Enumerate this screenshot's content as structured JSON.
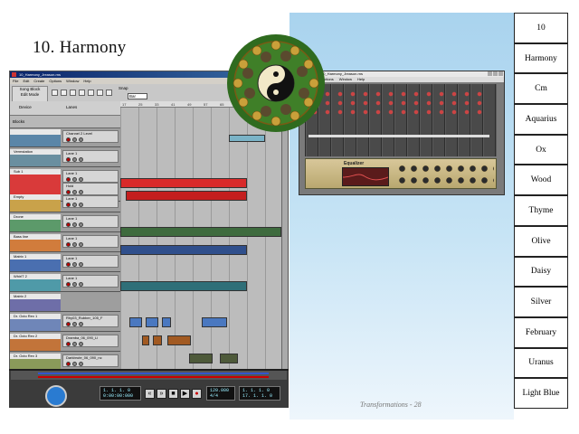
{
  "slide": {
    "title": "10. Harmony",
    "footer": "Transformations - 28"
  },
  "sequencer": {
    "window_title": "10_Harmony_Jreason.rns",
    "menu": [
      "File",
      "Edit",
      "Create",
      "Options",
      "Window",
      "Help"
    ],
    "mode": {
      "song": "Song",
      "block": "Block",
      "edit_mode": "Edit Mode"
    },
    "snap_label": "Snap",
    "snap_value": "Bar",
    "header": {
      "device": "Device",
      "lanes": "Lanes"
    },
    "blocks_label": "Blocks",
    "ruler": [
      "17",
      "25",
      "33",
      "41",
      "49",
      "57",
      "65",
      "73",
      "81",
      "89",
      "97"
    ],
    "tracks": [
      {
        "name": "",
        "lanes": [
          "Channel 2 Level"
        ],
        "color": "#5b86a8"
      },
      {
        "name": "Vermstation",
        "lanes": [
          "Lane 1"
        ],
        "color": "#6a8fa0"
      },
      {
        "name": "Sub 1",
        "lanes": [
          "Lane 1",
          "Hold"
        ],
        "color": "#d93a3a"
      },
      {
        "name": "Empty",
        "lanes": [
          "Lane 1"
        ],
        "color": "#c9a24a"
      },
      {
        "name": "Drone",
        "lanes": [
          "Lane 1"
        ],
        "color": "#5c9a6a"
      },
      {
        "name": "Bass line",
        "lanes": [
          "Lane 1"
        ],
        "color": "#d17c3c"
      },
      {
        "name": "Matrix 1",
        "lanes": [
          "Lane 1"
        ],
        "color": "#4a6fb0"
      },
      {
        "name": "WhirlT 2",
        "lanes": [
          "Lane 1"
        ],
        "color": "#4f9aa8"
      },
      {
        "name": "Matrix 2",
        "lanes": [],
        "color": "#6e6ea8"
      },
      {
        "name": "Dr. Octo Rex 1",
        "lanes": [
          "Rhy03_Rubber_105_F"
        ],
        "color": "#6f86b8"
      },
      {
        "name": "Dr. Octo Rex 2",
        "lanes": [
          "Dramba_06_090_Ll"
        ],
        "color": "#c2743a"
      },
      {
        "name": "Dr. Octo Rex 3",
        "lanes": [
          "Darkbrute_06_090_nc"
        ],
        "color": "#8a9a5a"
      }
    ],
    "transport": {
      "position": "1. 1. 1. 0",
      "time": "0:00:00:000",
      "tempo": "120.000",
      "signature": "4/4",
      "left_loc": "1. 1. 1. 0",
      "right_loc": "17. 1. 1. 0",
      "quant": "Loop"
    }
  },
  "mixer": {
    "window_title": "10_Harmony_Jreason.rns",
    "menu": [
      "Options",
      "Window",
      "Help"
    ],
    "eq_label": "Equalizer"
  },
  "answers": [
    "10",
    "Harmony",
    "Cm",
    "Aquarius",
    "Ox",
    "Wood",
    "Thyme",
    "Olive",
    "Daisy",
    "Silver",
    "February",
    "Uranus",
    "Light Blue"
  ]
}
